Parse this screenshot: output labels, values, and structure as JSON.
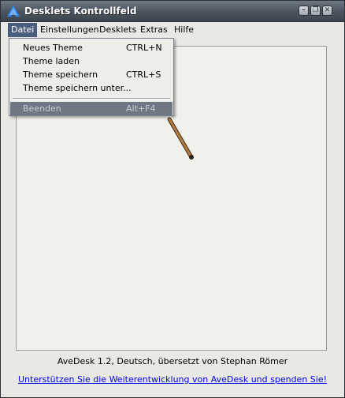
{
  "window": {
    "title": "Desklets Kontrollfeld",
    "minimize_glyph": "–",
    "restore_glyph": "❐",
    "close_glyph": "✕"
  },
  "menubar": {
    "items": [
      {
        "label": "Datei"
      },
      {
        "label": "Einstellungen"
      },
      {
        "label": "Desklets"
      },
      {
        "label": "Extras"
      },
      {
        "label": "Hilfe"
      }
    ]
  },
  "file_menu": {
    "items": [
      {
        "label": "Neues Theme",
        "shortcut": "CTRL+N"
      },
      {
        "label": "Theme laden",
        "shortcut": ""
      },
      {
        "label": "Theme speichern",
        "shortcut": "CTRL+S"
      },
      {
        "label": "Theme speichern unter...",
        "shortcut": ""
      },
      {
        "label": "Beenden",
        "shortcut": "Alt+F4"
      }
    ]
  },
  "footer": {
    "info": "AveDesk 1.2, Deutsch, übersetzt von Stephan Römer",
    "link": "Unterstützen Sie die Weiterentwicklung von AveDesk und spenden Sie!"
  },
  "colors": {
    "titlebar": "#4d5661",
    "menu_highlight": "#4a5d7e",
    "link": "#0000ee"
  },
  "icons": {
    "app": "avedesk-logo-icon",
    "pointer": "magic-wand-icon"
  }
}
